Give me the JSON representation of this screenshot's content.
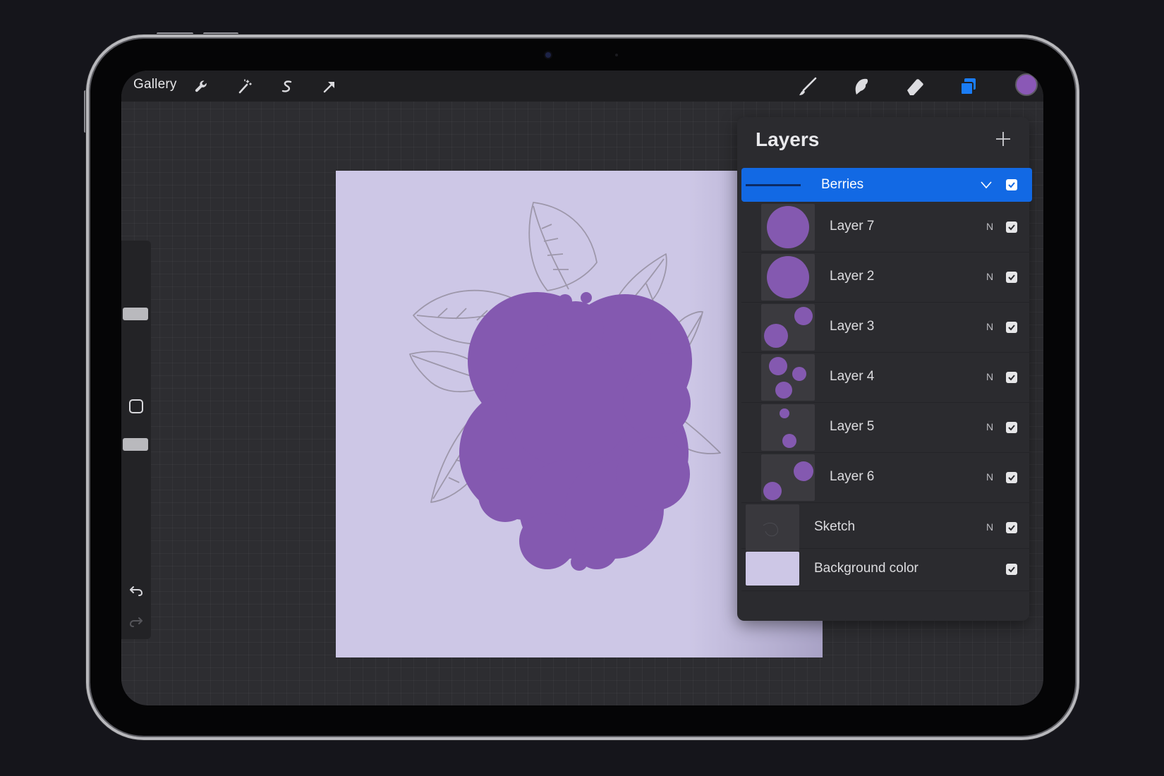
{
  "toolbar": {
    "gallery_label": "Gallery",
    "left_tools": [
      "wrench-icon",
      "magic-wand-icon",
      "selection-icon",
      "transform-arrow-icon"
    ],
    "right_tools": [
      "brush-icon",
      "smudge-icon",
      "eraser-icon",
      "layers-icon"
    ],
    "active_tool": "layers-icon",
    "current_color": "#8a58b6",
    "active_color": "#1a7cf5"
  },
  "canvas": {
    "background_color": "#cdc7e6",
    "berry_color": "#8459b0",
    "sketch_color": "#9d97aa"
  },
  "layers": {
    "title": "Layers",
    "add_icon": "plus-icon",
    "group": {
      "name": "Berries",
      "visible": true,
      "icon": "chevron-down-icon"
    },
    "items": [
      {
        "name": "Layer 7",
        "blend": "N",
        "visible": true,
        "thumb": "large-circle"
      },
      {
        "name": "Layer 2",
        "blend": "N",
        "visible": true,
        "thumb": "large-circle"
      },
      {
        "name": "Layer 3",
        "blend": "N",
        "visible": true,
        "thumb": "two-circles"
      },
      {
        "name": "Layer 4",
        "blend": "N",
        "visible": true,
        "thumb": "three-circles"
      },
      {
        "name": "Layer 5",
        "blend": "N",
        "visible": true,
        "thumb": "two-small-circles"
      },
      {
        "name": "Layer 6",
        "blend": "N",
        "visible": true,
        "thumb": "two-circles-alt"
      },
      {
        "name": "Sketch",
        "blend": "N",
        "visible": true,
        "thumb": "sketch"
      },
      {
        "name": "Background color",
        "blend": "",
        "visible": true,
        "thumb": "color"
      }
    ]
  }
}
